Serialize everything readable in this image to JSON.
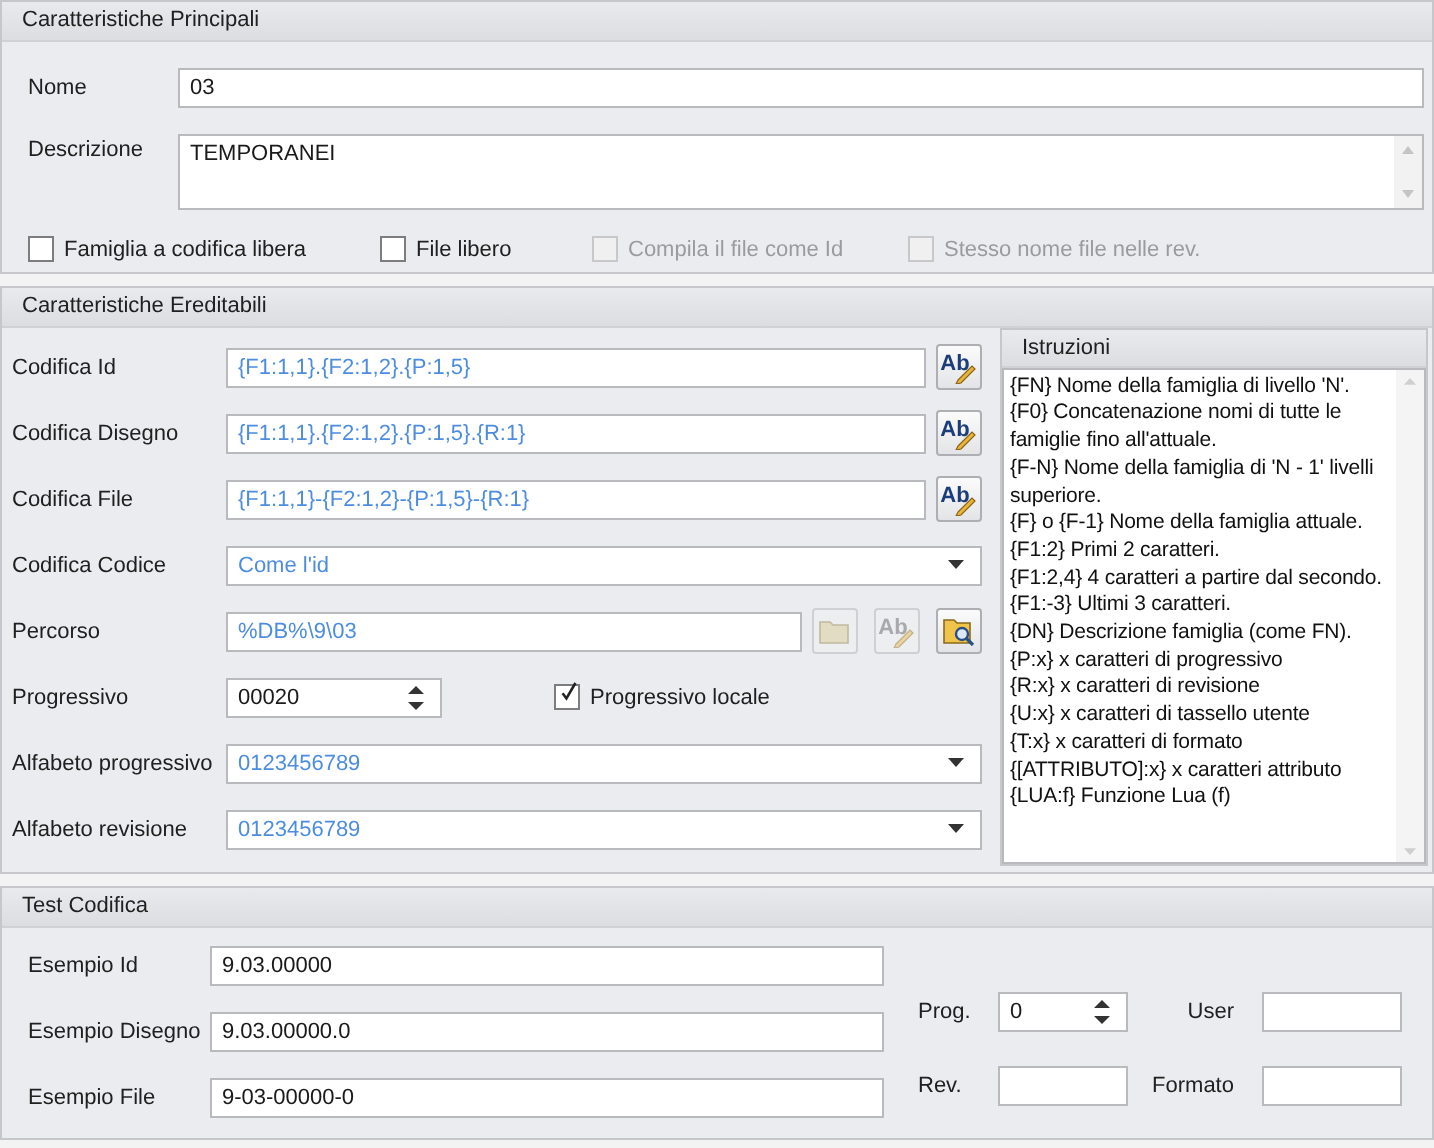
{
  "main": {
    "title": "Caratteristiche Principali",
    "fields": [
      {
        "label": "Nome",
        "kind": "text",
        "value": "03"
      },
      {
        "label": "Descrizione",
        "kind": "memo",
        "value": "TEMPORANEI"
      }
    ],
    "options": [
      {
        "label": "Famiglia a codifica libera",
        "checked": false,
        "disabled": false
      },
      {
        "label": "File libero",
        "checked": false,
        "disabled": false
      },
      {
        "label": "Compila il file come Id",
        "checked": false,
        "disabled": true
      },
      {
        "label": "Stesso nome file nelle rev.",
        "checked": false,
        "disabled": true
      }
    ]
  },
  "inherited": {
    "title": "Caratteristiche Ereditabili",
    "rows": [
      {
        "label": "Codifica Id",
        "kind": "formula",
        "value": "{F1:1,1}.{F2:1,2}.{P:1,5}",
        "buttons": [
          {
            "kind": "rename",
            "glyph": "Ab",
            "disabled": false
          }
        ]
      },
      {
        "label": "Codifica Disegno",
        "kind": "formula",
        "value": "{F1:1,1}.{F2:1,2}.{P:1,5}.{R:1}",
        "buttons": [
          {
            "kind": "rename",
            "glyph": "Ab",
            "disabled": false
          }
        ]
      },
      {
        "label": "Codifica File",
        "kind": "formula",
        "value": "{F1:1,1}-{F2:1,2}-{P:1,5}-{R:1}",
        "buttons": [
          {
            "kind": "rename",
            "glyph": "Ab",
            "disabled": false
          }
        ]
      },
      {
        "label": "Codifica Codice",
        "kind": "combo",
        "value": "Come l'id"
      },
      {
        "label": "Percorso",
        "kind": "formula",
        "value": "%DB%\\9\\03",
        "buttons": [
          {
            "kind": "folder",
            "disabled": true
          },
          {
            "kind": "rename",
            "glyph": "Ab",
            "disabled": true
          },
          {
            "kind": "browse",
            "disabled": false
          }
        ]
      },
      {
        "label": "Progressivo",
        "kind": "spin",
        "value": "00020",
        "option": {
          "label": "Progressivo locale",
          "checked": true,
          "disabled": false
        }
      },
      {
        "label": "Alfabeto progressivo",
        "kind": "combo",
        "value": "0123456789"
      },
      {
        "label": "Alfabeto revisione",
        "kind": "combo",
        "value": "0123456789"
      }
    ],
    "help": {
      "title": "Istruzioni",
      "lines": [
        "{FN} Nome della famiglia di livello 'N'.",
        "{F0} Concatenazione nomi di tutte le famiglie fino all'attuale.",
        "{F-N} Nome della famiglia di 'N - 1' livelli superiore.",
        "{F} o {F-1} Nome della famiglia attuale.",
        "{F1:2} Primi 2 caratteri.",
        "{F1:2,4} 4 caratteri a partire dal secondo.",
        "{F1:-3} Ultimi 3 caratteri.",
        "{DN} Descrizione famiglia (come FN).",
        "{P:x} x caratteri di progressivo",
        "{R:x} x caratteri di revisione",
        "{U:x} x caratteri di tassello utente",
        "{T:x} x caratteri di formato",
        "{[ATTRIBUTO]:x} x caratteri attributo",
        "{LUA:f} Funzione Lua (f)"
      ]
    }
  },
  "test": {
    "title": "Test Codifica",
    "examples": [
      {
        "label": "Esempio Id",
        "value": "9.03.00000"
      },
      {
        "label": "Esempio Disegno",
        "value": "9.03.00000.0"
      },
      {
        "label": "Esempio File",
        "value": "9-03-00000-0"
      }
    ],
    "params": [
      {
        "label": "Prog.",
        "kind": "spin",
        "value": "0"
      },
      {
        "label": "User",
        "kind": "text"
      },
      {
        "label": "Rev.",
        "kind": "text"
      },
      {
        "label": "Formato",
        "kind": "text"
      }
    ]
  }
}
